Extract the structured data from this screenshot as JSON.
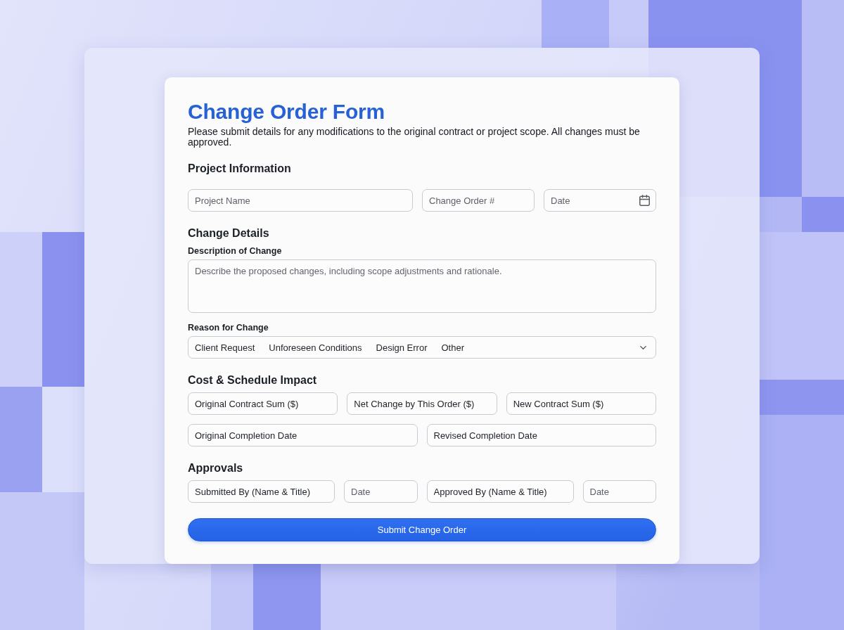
{
  "form": {
    "title": "Change Order Form",
    "intro": "Please submit details for any modifications to the original contract or project scope. All changes must be approved."
  },
  "project_information": {
    "heading": "Project Information",
    "fields": [
      {
        "kind": "text",
        "placeholder": "Project Name"
      },
      {
        "kind": "text",
        "placeholder": "Change Order #"
      },
      {
        "kind": "date_picker",
        "placeholder": "Date"
      }
    ]
  },
  "change_details": {
    "heading": "Change Details",
    "description": {
      "label": "Description of Change",
      "placeholder": "Describe the proposed changes, including scope adjustments and rationale."
    },
    "reason": {
      "label": "Reason for Change",
      "options": [
        "Client Request",
        "Unforeseen Conditions",
        "Design Error",
        "Other"
      ]
    }
  },
  "cost_schedule_impact": {
    "heading": "Cost & Schedule Impact",
    "rows": [
      [
        {
          "kind": "text",
          "value": "Original Contract Sum ($)"
        },
        {
          "kind": "text",
          "value": "Net Change by This Order ($)"
        },
        {
          "kind": "text",
          "value": "New Contract Sum ($)"
        }
      ],
      [
        {
          "kind": "text",
          "value": "Original Completion Date"
        },
        {
          "kind": "text",
          "value": "Revised Completion Date"
        }
      ]
    ]
  },
  "approvals": {
    "heading": "Approvals",
    "fields": [
      {
        "kind": "text",
        "value": "Submitted By (Name & Title)"
      },
      {
        "kind": "text",
        "placeholder": "Date"
      },
      {
        "kind": "text",
        "value": "Approved By (Name & Title)"
      },
      {
        "kind": "text",
        "placeholder": "Date"
      }
    ]
  },
  "submit_button": "Submit Change Order"
}
